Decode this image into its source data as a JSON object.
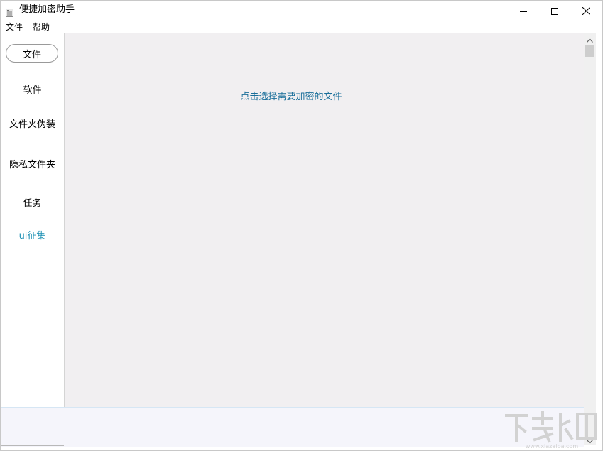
{
  "window": {
    "title": "便捷加密助手"
  },
  "menu": {
    "file": "文件",
    "help": "帮助"
  },
  "sidebar": {
    "items": [
      {
        "label": "文件",
        "active": true
      },
      {
        "label": "软件"
      },
      {
        "label": "文件夹伪装"
      },
      {
        "label": "隐私文件夹"
      },
      {
        "label": "任务"
      },
      {
        "label": "ui征集",
        "accent": true
      }
    ]
  },
  "main": {
    "prompt": "点击选择需要加密的文件"
  },
  "colors": {
    "accent": "#1a8fb3",
    "prompt": "#1a6f9a",
    "content_bg": "#f1eff1"
  },
  "icons": {
    "app": "app-file-icon",
    "minimize": "minimize-icon",
    "maximize": "maximize-icon",
    "close": "close-icon",
    "scroll_up": "chevron-up-icon",
    "scroll_down": "chevron-down-icon",
    "watermark": "watermark-logo-icon"
  }
}
